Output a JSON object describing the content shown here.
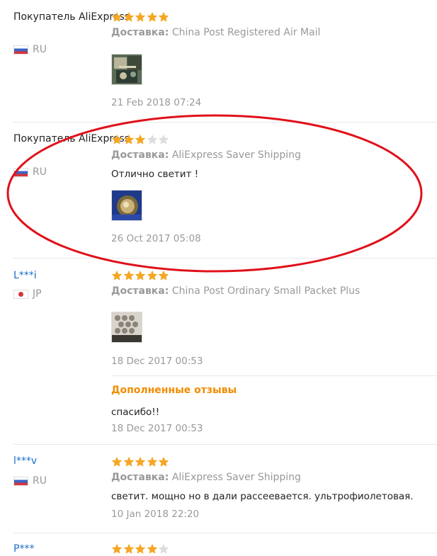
{
  "reviews": [
    {
      "name": "Покупатель AliExpress",
      "country": "RU",
      "rating": 5,
      "delivery_label": "Доставка:",
      "delivery": "China Post Registered Air Mail",
      "text": "",
      "date": "21 Feb 2018 07:24"
    },
    {
      "name": "Покупатель AliExpress",
      "country": "RU",
      "rating": 3,
      "delivery_label": "Доставка:",
      "delivery": "AliExpress Saver Shipping",
      "text": "Отлично светит !",
      "date": "26 Oct 2017 05:08"
    },
    {
      "name": "L***i",
      "country": "JP",
      "rating": 5,
      "delivery_label": "Доставка:",
      "delivery": "China Post Ordinary Small Packet Plus",
      "text": "",
      "date": "18 Dec 2017 00:53",
      "additional": {
        "label": "Дополненные отзывы",
        "text": "спасибо!!",
        "date": "18 Dec 2017 00:53"
      }
    },
    {
      "name": "l***v",
      "country": "RU",
      "rating": 5,
      "delivery_label": "Доставка:",
      "delivery": "AliExpress Saver Shipping",
      "text": "светит. мощно но в дали рассеевается. ультрофиолетовая.",
      "date": "10 Jan 2018 22:20"
    },
    {
      "name": "P***",
      "rating": 4
    }
  ],
  "colors": {
    "star_filled": "#f5a623",
    "star_empty": "#dddddd",
    "additional_label": "#f08c00",
    "highlight_ellipse": "#e0101a"
  }
}
